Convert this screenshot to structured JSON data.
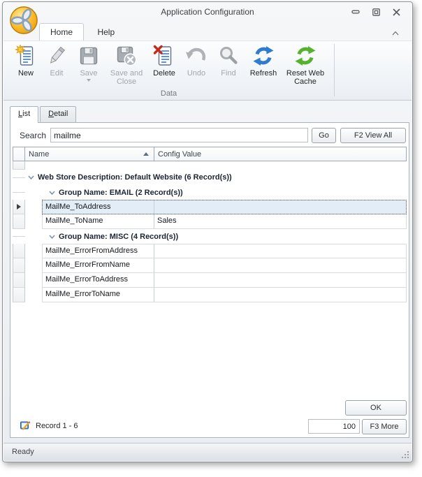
{
  "window": {
    "title": "Application Configuration"
  },
  "ribbon": {
    "tabs": [
      {
        "label": "Home"
      },
      {
        "label": "Help"
      }
    ],
    "buttons": [
      {
        "label": "New",
        "icon": "new-document-icon",
        "enabled": true
      },
      {
        "label": "Edit",
        "icon": "pencil-icon",
        "enabled": false
      },
      {
        "label": "Save",
        "icon": "save-icon",
        "enabled": false,
        "has_dropdown": true
      },
      {
        "label": "Save and Close",
        "icon": "save-and-close-icon",
        "enabled": false
      },
      {
        "label": "Delete",
        "icon": "delete-document-icon",
        "enabled": true
      },
      {
        "label": "Undo",
        "icon": "undo-icon",
        "enabled": false
      },
      {
        "label": "Find",
        "icon": "search-icon",
        "enabled": false
      },
      {
        "label": "Refresh",
        "icon": "refresh-icon",
        "enabled": true
      },
      {
        "label": "Reset Web Cache",
        "icon": "reset-web-cache-icon",
        "enabled": true
      }
    ],
    "group_label": "Data"
  },
  "view_tabs": {
    "list": "List",
    "detail": "Detail"
  },
  "search": {
    "label": "Search",
    "value": "mailme",
    "go_label": "Go",
    "view_all_label": "F2 View All"
  },
  "grid": {
    "columns": {
      "name": "Name",
      "value": "Config Value",
      "sort": "ascending"
    },
    "group_webstore": {
      "label": "Web Store Description: Default Website (6 Record(s))"
    },
    "group_email": {
      "label": "Group Name: EMAIL (2 Record(s))"
    },
    "group_misc": {
      "label": "Group Name: MISC (4 Record(s))"
    },
    "rows": [
      {
        "name": "MailMe_ToAddress",
        "value": "",
        "selected": true
      },
      {
        "name": "MailMe_ToName",
        "value": "Sales",
        "selected": false
      },
      {
        "name": "MailMe_ErrorFromAddress",
        "value": "",
        "selected": false
      },
      {
        "name": "MailMe_ErrorFromName",
        "value": "",
        "selected": false
      },
      {
        "name": "MailMe_ErrorToAddress",
        "value": "",
        "selected": false
      },
      {
        "name": "MailMe_ErrorToName",
        "value": "",
        "selected": false
      }
    ]
  },
  "footer": {
    "ok_label": "OK",
    "record_text": "Record 1 - 6",
    "page_size": "100",
    "more_label": "F3 More"
  },
  "status_bar": {
    "text": "Ready"
  },
  "colors": {
    "selection_bg": "#e3edf8",
    "refresh_icon_blue": "#2e7bd0",
    "reset_icon_green": "#55b22c",
    "logo_orange": "#f2a71b",
    "delete_x_red": "#c22a1c",
    "new_star_yellow": "#ffd23e"
  }
}
